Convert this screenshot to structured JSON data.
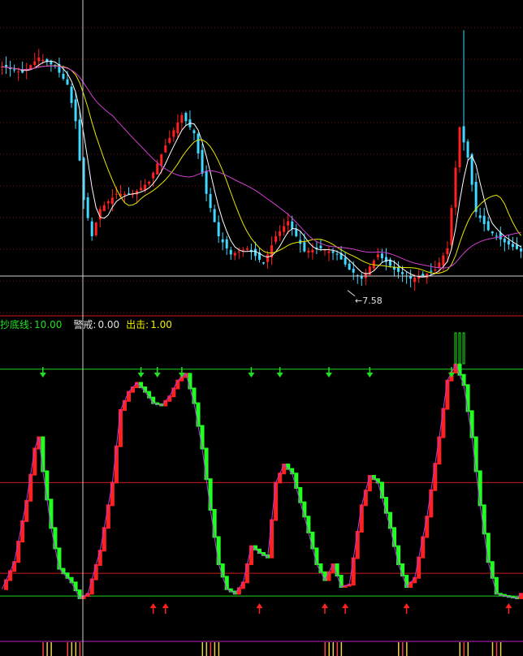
{
  "colors": {
    "background": "#000000",
    "up": "#ff2020",
    "down": "#40d8ff",
    "ma_white": "#ffffff",
    "ma_yellow": "#e8e800",
    "ma_magenta": "#d040d0",
    "grid": "#7a1010",
    "level_line": "#20d020",
    "mid_line": "#d01818",
    "osc_up": "#ff2020",
    "osc_down": "#20ff20",
    "arrow_down": "#20e020",
    "arrow_up": "#ff2020",
    "bottom_bar": "#e8d040",
    "legend_green": "#20e020",
    "legend_white": "#e0e0e0",
    "legend_yellow": "#f0f000"
  },
  "legend": {
    "item1_label": "抄底线:",
    "item1_value": "10.00",
    "item2_label": "警戒:",
    "item2_value": "0.00",
    "item3_label": "出击:",
    "item3_value": "1.00"
  },
  "low_marker": {
    "text": "←7.58",
    "value": 7.58
  },
  "chart_data": [
    {
      "type": "candlestick",
      "title": "",
      "x_count": 128,
      "y_range": [
        7.2,
        12.4
      ],
      "annotations": [
        {
          "text": "←7.58",
          "value": 7.58
        }
      ],
      "close_keypoints": [
        [
          0,
          11.3
        ],
        [
          5,
          11.2
        ],
        [
          9,
          11.45
        ],
        [
          13,
          11.3
        ],
        [
          16,
          11.0
        ],
        [
          18,
          10.4
        ],
        [
          20,
          9.1
        ],
        [
          22,
          8.5
        ],
        [
          24,
          8.95
        ],
        [
          28,
          9.2
        ],
        [
          32,
          9.2
        ],
        [
          36,
          9.4
        ],
        [
          40,
          10.0
        ],
        [
          44,
          10.5
        ],
        [
          47,
          10.2
        ],
        [
          50,
          9.2
        ],
        [
          53,
          8.5
        ],
        [
          56,
          8.2
        ],
        [
          60,
          8.3
        ],
        [
          64,
          8.05
        ],
        [
          67,
          8.5
        ],
        [
          70,
          8.75
        ],
        [
          74,
          8.25
        ],
        [
          78,
          8.3
        ],
        [
          82,
          8.2
        ],
        [
          85,
          7.95
        ],
        [
          88,
          7.8
        ],
        [
          92,
          8.2
        ],
        [
          96,
          7.95
        ],
        [
          100,
          7.8
        ],
        [
          103,
          7.85
        ],
        [
          106,
          7.95
        ],
        [
          109,
          8.3
        ],
        [
          112,
          10.3
        ],
        [
          114,
          9.8
        ],
        [
          116,
          8.9
        ],
        [
          119,
          8.6
        ],
        [
          123,
          8.4
        ],
        [
          127,
          8.25
        ]
      ],
      "spikes": [
        {
          "index": 113,
          "high": 11.9
        }
      ]
    },
    {
      "type": "line",
      "title": "",
      "x_count": 128,
      "y_range": [
        -2,
        11.6
      ],
      "levels": {
        "抄底线": 10,
        "警戒": 0,
        "出击": 1,
        "mid": 5
      },
      "oscillator_keypoints": [
        [
          0,
          0.3
        ],
        [
          3,
          1.5
        ],
        [
          6,
          4.2
        ],
        [
          8,
          6.5
        ],
        [
          9,
          7.0
        ],
        [
          10,
          5.5
        ],
        [
          12,
          3.0
        ],
        [
          14,
          1.2
        ],
        [
          17,
          0.6
        ],
        [
          19,
          -0.1
        ],
        [
          21,
          0.1
        ],
        [
          24,
          2.0
        ],
        [
          27,
          5.0
        ],
        [
          29,
          8.2
        ],
        [
          31,
          9.0
        ],
        [
          33,
          9.4
        ],
        [
          35,
          9.0
        ],
        [
          37,
          8.5
        ],
        [
          39,
          8.4
        ],
        [
          41,
          8.8
        ],
        [
          43,
          9.5
        ],
        [
          45,
          9.8
        ],
        [
          47,
          8.5
        ],
        [
          49,
          6.5
        ],
        [
          51,
          3.8
        ],
        [
          53,
          1.4
        ],
        [
          55,
          0.3
        ],
        [
          57,
          0.1
        ],
        [
          59,
          0.6
        ],
        [
          61,
          2.2
        ],
        [
          63,
          1.9
        ],
        [
          65,
          1.7
        ],
        [
          67,
          5.0
        ],
        [
          69,
          5.8
        ],
        [
          71,
          5.4
        ],
        [
          74,
          3.5
        ],
        [
          77,
          1.4
        ],
        [
          79,
          0.7
        ],
        [
          81,
          1.4
        ],
        [
          83,
          0.4
        ],
        [
          85,
          0.5
        ],
        [
          88,
          4.0
        ],
        [
          90,
          5.3
        ],
        [
          92,
          5.0
        ],
        [
          95,
          3.0
        ],
        [
          97,
          1.4
        ],
        [
          99,
          0.4
        ],
        [
          101,
          0.8
        ],
        [
          104,
          3.5
        ],
        [
          107,
          7.0
        ],
        [
          109,
          9.5
        ],
        [
          111,
          10.2
        ],
        [
          113,
          9.3
        ],
        [
          115,
          7.0
        ],
        [
          117,
          4.0
        ],
        [
          119,
          1.5
        ],
        [
          121,
          0.1
        ],
        [
          123,
          0.0
        ],
        [
          126,
          -0.1
        ],
        [
          127,
          0.1
        ]
      ],
      "down_arrows_at": [
        10,
        34,
        38,
        44,
        61,
        68,
        80,
        90,
        110
      ],
      "up_arrows_at": [
        37,
        40,
        63,
        79,
        84,
        99,
        124
      ],
      "bottom_signal_bars_at": [
        10,
        11,
        12,
        16,
        17,
        18,
        19,
        49,
        50,
        51,
        52,
        53,
        79,
        80,
        81,
        82,
        83,
        97,
        98,
        99,
        112,
        113,
        114,
        120,
        121,
        122
      ]
    }
  ]
}
